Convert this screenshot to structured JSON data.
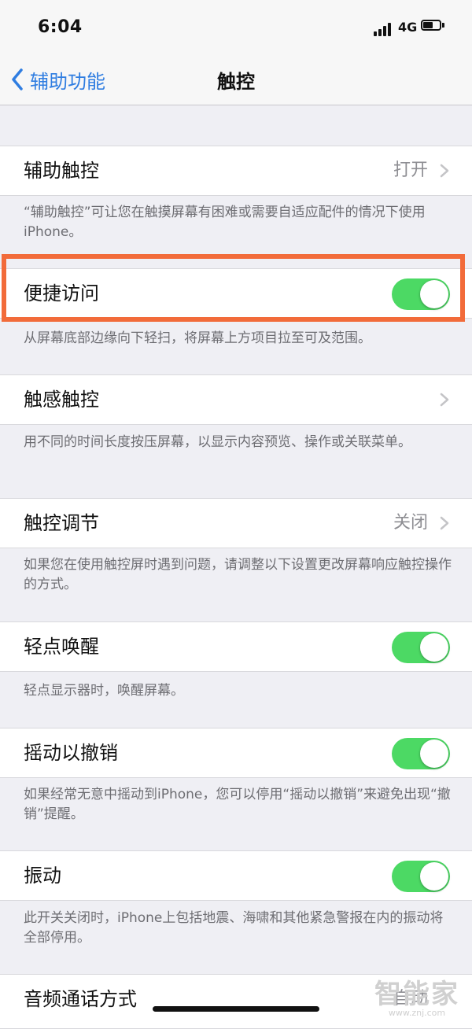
{
  "status": {
    "time": "6:04",
    "network": "4G"
  },
  "nav": {
    "back_label": "辅助功能",
    "title": "触控"
  },
  "settings": [
    {
      "label": "辅助触控",
      "value": "打开",
      "footer": "“辅助触控”可让您在触摸屏幕有困难或需要自适应配件的情况下使用iPhone。"
    },
    {
      "label": "便捷访问",
      "toggle": true,
      "footer": "从屏幕底部边缘向下轻扫，将屏幕上方项目拉至可及范围。"
    },
    {
      "label": "触感触控",
      "footer": "用不同的时间长度按压屏幕，以显示内容预览、操作或关联菜单。"
    },
    {
      "label": "触控调节",
      "value": "关闭",
      "footer": "如果您在使用触控屏时遇到问题，请调整以下设置更改屏幕响应触控操作的方式。"
    },
    {
      "label": "轻点唤醒",
      "toggle": true,
      "footer": "轻点显示器时，唤醒屏幕。"
    },
    {
      "label": "摇动以撤销",
      "toggle": true,
      "footer": "如果经常无意中摇动到iPhone，您可以停用“摇动以撤销”来避免出现“撤销”提醒。"
    },
    {
      "label": "振动",
      "toggle": true,
      "footer": "此开关关闭时，iPhone上包括地震、海啸和其他紧急警报在内的振动将全部停用。"
    },
    {
      "label": "音频通话方式",
      "value": "自动"
    }
  ],
  "watermark": {
    "big": "智能家",
    "small": "www.znj.com"
  },
  "colors": {
    "accent": "#2f7de1",
    "toggle_on": "#4cd964",
    "highlight": "#f26b3a"
  }
}
